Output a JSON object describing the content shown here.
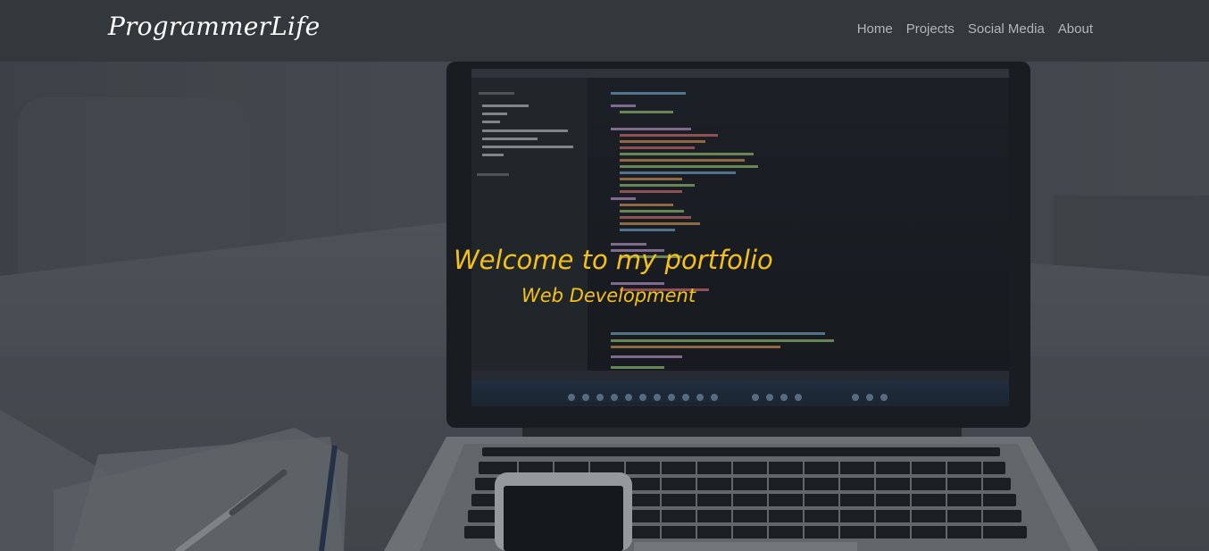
{
  "navbar": {
    "brand": "ProgrammerLife",
    "links": [
      {
        "label": "Home"
      },
      {
        "label": "Projects"
      },
      {
        "label": "Social Media"
      },
      {
        "label": "About"
      }
    ]
  },
  "hero": {
    "title": "Welcome to my portfolio",
    "subtitle": "Web Development"
  },
  "colors": {
    "navbar_bg": "#34383d",
    "accent_text": "#f5c116",
    "nav_link": "#b3b6ba"
  },
  "icons": [
    "laptop-image",
    "phone-image",
    "notebook-image",
    "pen-image"
  ]
}
